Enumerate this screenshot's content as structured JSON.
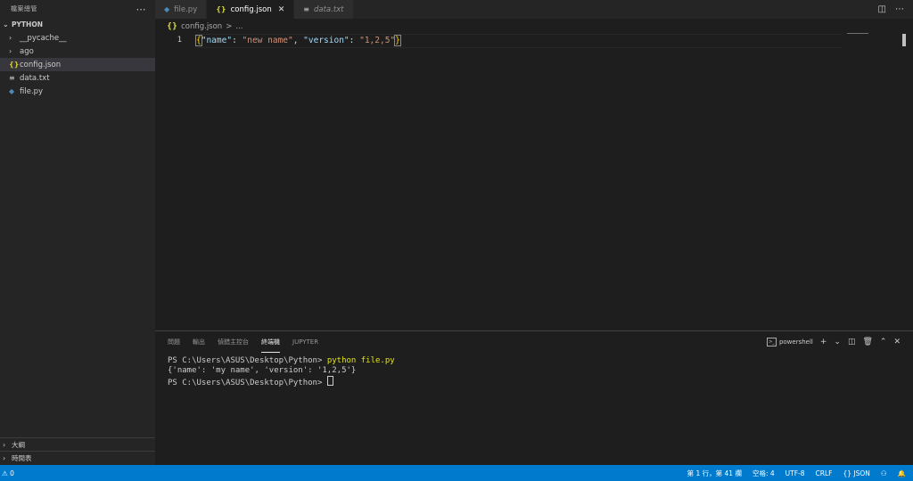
{
  "sidebar": {
    "title": "檔案總管",
    "more_icon": "ellipsis-icon",
    "project": "PYTHON",
    "items": [
      {
        "label": "__pycache__",
        "icon": "chevron-right-icon"
      },
      {
        "label": "ago",
        "icon": "chevron-right-icon"
      },
      {
        "label": "config.json",
        "icon": "json-file-icon",
        "icon_text": "{}"
      },
      {
        "label": "data.txt",
        "icon": "text-file-icon",
        "icon_text": "≡"
      },
      {
        "label": "file.py",
        "icon": "python-file-icon",
        "icon_text": "◆"
      }
    ],
    "outline": "大綱",
    "timeline": "時間表"
  },
  "tabs": [
    {
      "label": "file.py",
      "icon_text": "◆"
    },
    {
      "label": "config.json",
      "icon_text": "{}",
      "close": "✕"
    },
    {
      "label": "data.txt",
      "icon_text": "≡"
    }
  ],
  "breadcrumb": {
    "icon": "{}",
    "file": "config.json",
    "sep": ">",
    "rest": "..."
  },
  "editor": {
    "line_number": "1",
    "tokens": {
      "open": "{",
      "key1": "\"name\"",
      "colon1": ": ",
      "val1": "\"new name\"",
      "comma": ", ",
      "key2": "\"version\"",
      "colon2": ": ",
      "val2": "\"1,2,5\"",
      "close": "}"
    }
  },
  "panel": {
    "tabs": [
      "問題",
      "輸出",
      "偵錯主控台",
      "終端機",
      "JUPYTER"
    ],
    "active_tab": "終端機",
    "shell": "powershell",
    "terminal": {
      "prompt1": "PS C:\\Users\\ASUS\\Desktop\\Python> ",
      "cmd": "python file.py",
      "output": "{'name': 'my name', 'version': '1,2,5'}",
      "prompt2": "PS C:\\Users\\ASUS\\Desktop\\Python> "
    }
  },
  "statusbar": {
    "warnings": "⚠ 0",
    "position": "第 1 行，第 41 欄",
    "indent": "空格: 4",
    "encoding": "UTF-8",
    "eol": "CRLF",
    "language": "JSON"
  },
  "colors": {
    "accent": "#007acc",
    "string": "#ce9178",
    "key": "#9cdcfe"
  }
}
